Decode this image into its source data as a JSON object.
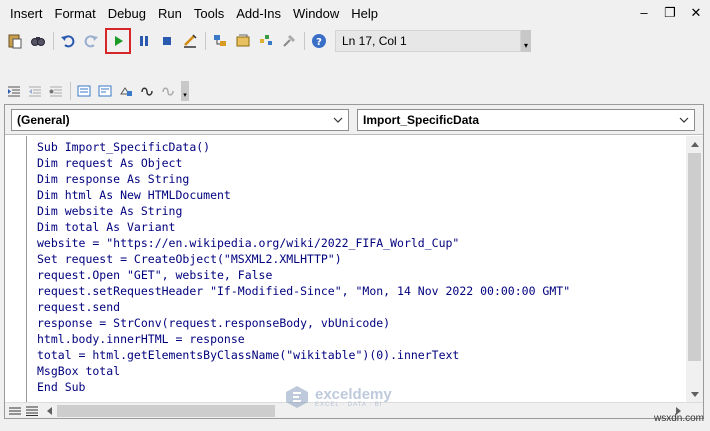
{
  "menu": [
    "Insert",
    "Format",
    "Debug",
    "Run",
    "Tools",
    "Add-Ins",
    "Window",
    "Help"
  ],
  "window_controls": {
    "minimize": "‒",
    "restore": "❐",
    "close": "✕"
  },
  "toolbar": {
    "status": "Ln 17, Col 1"
  },
  "combos": {
    "object": "(General)",
    "procedure": "Import_SpecificData"
  },
  "code": [
    "Sub Import_SpecificData()",
    "Dim request As Object",
    "Dim response As String",
    "Dim html As New HTMLDocument",
    "Dim website As String",
    "Dim total As Variant",
    "website = \"https://en.wikipedia.org/wiki/2022_FIFA_World_Cup\"",
    "Set request = CreateObject(\"MSXML2.XMLHTTP\")",
    "request.Open \"GET\", website, False",
    "request.setRequestHeader \"If-Modified-Since\", \"Mon, 14 Nov 2022 00:00:00 GMT\"",
    "request.send",
    "response = StrConv(request.responseBody, vbUnicode)",
    "html.body.innerHTML = response",
    "total = html.getElementsByClassName(\"wikitable\")(0).innerText",
    "MsgBox total",
    "End Sub"
  ],
  "watermark": {
    "title": "exceldemy",
    "tagline": "EXCEL · DATA · BI"
  },
  "site": "wsxdn.com",
  "colors": {
    "run_highlight": "#d62728",
    "run_icon": "#1e9a28",
    "code_text": "#00007f"
  }
}
